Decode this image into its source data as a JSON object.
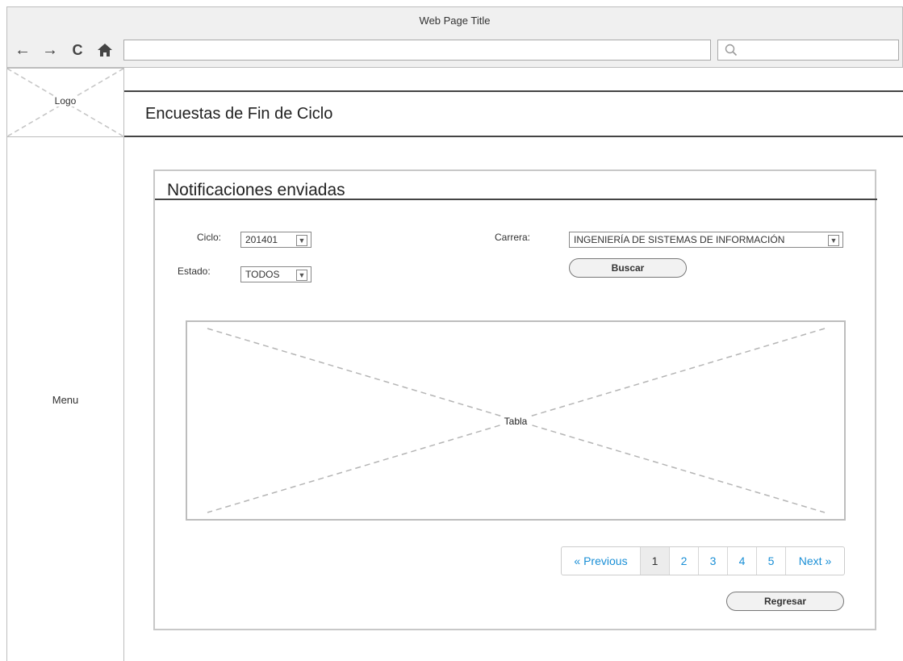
{
  "browser": {
    "window_title": "Web Page Title",
    "url": "",
    "search_placeholder": ""
  },
  "logo": {
    "label": "Logo"
  },
  "sidebar": {
    "label": "Menu"
  },
  "header": {
    "title": "Encuestas de Fin de Ciclo"
  },
  "panel": {
    "title": "Notificaciones enviadas",
    "filters": {
      "ciclo_label": "Ciclo:",
      "ciclo_value": "201401",
      "estado_label": "Estado:",
      "estado_value": "TODOS",
      "carrera_label": "Carrera:",
      "carrera_value": "INGENIERÍA DE SISTEMAS DE INFORMACIÓN"
    },
    "search_button": "Buscar",
    "table_placeholder": "Tabla",
    "pagination": {
      "previous": "« Previous",
      "pages": [
        "1",
        "2",
        "3",
        "4",
        "5"
      ],
      "active_page": "1",
      "next": "Next »"
    },
    "back_button": "Regresar"
  },
  "colors": {
    "link": "#1a8fd6",
    "chrome_bg": "#f0f0f0",
    "border": "#bdbdbd"
  }
}
